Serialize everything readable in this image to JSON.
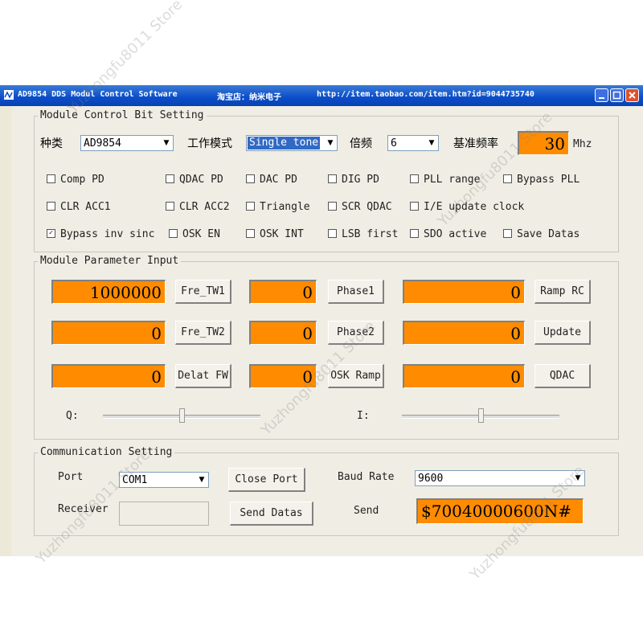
{
  "window": {
    "app_title": "AD9854 DDS Modul Control Software",
    "shop_label": "淘宝店：纳米电子",
    "url": "http://item.taobao.com/item.htm?id=9044735740"
  },
  "control_bits": {
    "group_title": "Module Control Bit Setting",
    "type_label": "种类",
    "type_value": "AD9854",
    "mode_label": "工作模式",
    "mode_value": "Single tone",
    "mult_label": "倍频",
    "mult_value": "6",
    "ref_label": "基准频率",
    "ref_value": "30",
    "ref_unit": "Mhz",
    "checkboxes": [
      {
        "label": "Comp PD",
        "checked": false
      },
      {
        "label": "QDAC PD",
        "checked": false
      },
      {
        "label": "DAC PD",
        "checked": false
      },
      {
        "label": "DIG PD",
        "checked": false
      },
      {
        "label": "PLL range",
        "checked": false
      },
      {
        "label": "Bypass PLL",
        "checked": false
      },
      {
        "label": "CLR ACC1",
        "checked": false
      },
      {
        "label": "CLR ACC2",
        "checked": false
      },
      {
        "label": "Triangle",
        "checked": false
      },
      {
        "label": "SCR QDAC",
        "checked": false
      },
      {
        "label": "I/E update clock",
        "checked": false
      },
      {
        "label": "Bypass inv sinc",
        "checked": true
      },
      {
        "label": "OSK EN",
        "checked": false
      },
      {
        "label": "OSK INT",
        "checked": false
      },
      {
        "label": "LSB first",
        "checked": false
      },
      {
        "label": "SDO active",
        "checked": false
      },
      {
        "label": "Save Datas",
        "checked": false
      }
    ]
  },
  "params": {
    "group_title": "Module Parameter Input",
    "fre_tw1_value": "1000000",
    "fre_tw1_btn": "Fre_TW1",
    "phase1_value": "0",
    "phase1_btn": "Phase1",
    "ramp_rc_value": "0",
    "ramp_rc_btn": "Ramp RC",
    "fre_tw2_value": "0",
    "fre_tw2_btn": "Fre_TW2",
    "phase2_value": "0",
    "phase2_btn": "Phase2",
    "update_value": "0",
    "update_btn": "Update",
    "delat_fw_value": "0",
    "delat_fw_btn": "Delat FW",
    "osk_ramp_value": "0",
    "osk_ramp_btn": "OSK Ramp",
    "qdac_value": "0",
    "qdac_btn": "QDAC",
    "q_label": "Q:",
    "q_level": 0.5,
    "i_label": "I:",
    "i_level": 0.5
  },
  "comm": {
    "group_title": "Communication Setting",
    "port_label": "Port",
    "port_value": "COM1",
    "close_port_btn": "Close Port",
    "baud_label": "Baud Rate",
    "baud_value": "9600",
    "receiver_label": "Receiver",
    "send_datas_btn": "Send Datas",
    "send_label": "Send",
    "send_value": "$70040000600N#"
  },
  "colors": {
    "accent_orange": "#ff8c00",
    "titlebar_blue": "#0a4dc9",
    "panel": "#f0eee4"
  },
  "watermark": "Yuzhongfu8011 Store"
}
